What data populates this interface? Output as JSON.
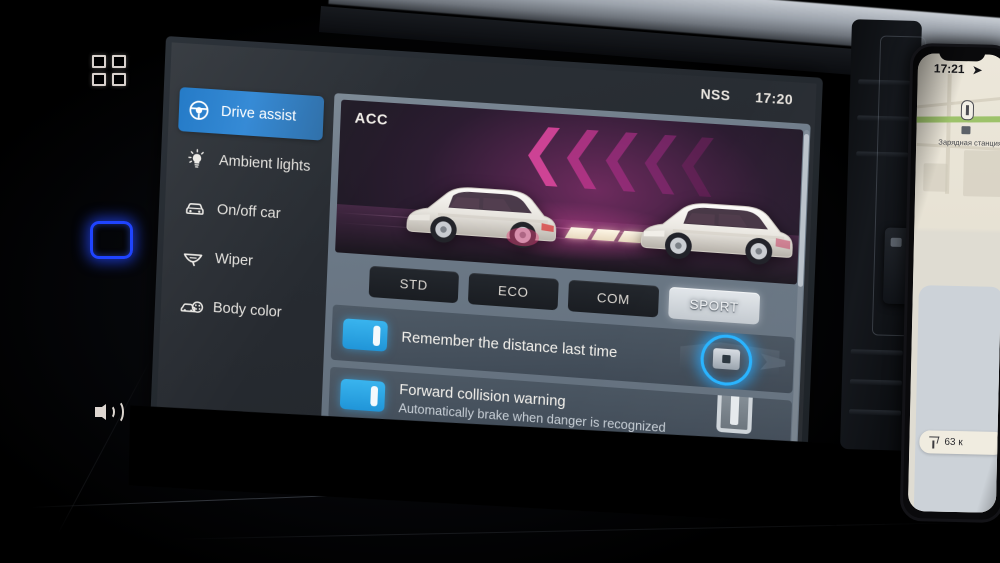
{
  "screen": {
    "statusbar": {
      "label": "NSS",
      "clock": "17:20"
    },
    "sidebar": {
      "items": [
        {
          "label": "Drive assist",
          "icon": "steering-wheel-icon",
          "active": true
        },
        {
          "label": "Ambient lights",
          "icon": "light-bulb-icon",
          "active": false
        },
        {
          "label": "On/off car",
          "icon": "car-front-icon",
          "active": false
        },
        {
          "label": "Wiper",
          "icon": "wiper-icon",
          "active": false
        },
        {
          "label": "Body color",
          "icon": "car-palette-icon",
          "active": false
        }
      ]
    },
    "content": {
      "hero": {
        "title": "ACC",
        "illustration": "two-cars-following-distance"
      },
      "modes": [
        {
          "label": "STD",
          "selected": false
        },
        {
          "label": "ECO",
          "selected": false
        },
        {
          "label": "COM",
          "selected": false
        },
        {
          "label": "SPORT",
          "selected": true
        }
      ],
      "settings": [
        {
          "title": "Remember the distance last time",
          "subtitle": "",
          "toggle_on": true,
          "art": "steering-wheel-controls-icon"
        },
        {
          "title": "Forward collision warning",
          "subtitle": "Automatically brake when danger is recognized",
          "toggle_on": true,
          "art": "clip-bracket-icon"
        }
      ]
    }
  },
  "hardware": {
    "apps_button": "apps-grid-button",
    "home_button": "home-button",
    "volume_button": "volume-button"
  },
  "phone": {
    "time": "17:21",
    "map_poi": "Зарядная станция",
    "distance": "63 к"
  },
  "colors": {
    "accent_blue": "#2e86d4",
    "toggle_blue": "#2095d8",
    "home_glow": "#1f44ff",
    "selected_button": "#e2e6ea"
  }
}
